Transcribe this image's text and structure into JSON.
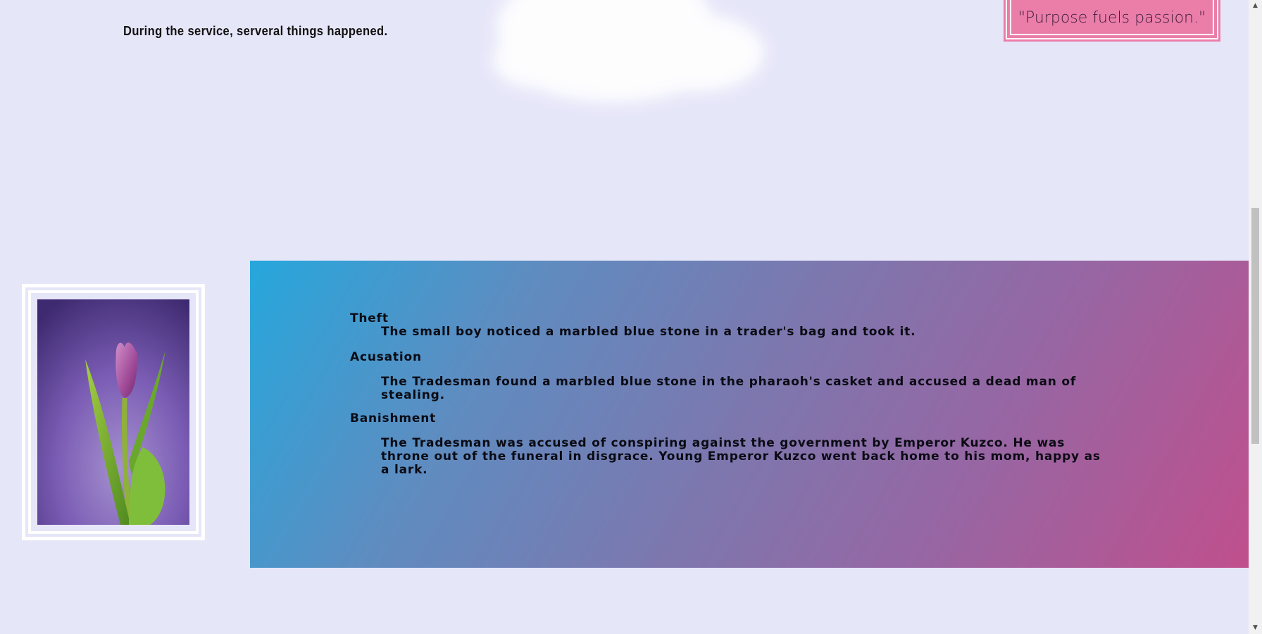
{
  "header": {
    "service_text": "During the service, serveral things happened.",
    "quote": "\"Purpose fuels passion.\""
  },
  "image": {
    "subject": "purple tulip photo"
  },
  "events": [
    {
      "term": "Theft",
      "description": "The small boy noticed a marbled blue stone in a trader's bag and took it."
    },
    {
      "term": "Acusation",
      "description": "The Tradesman found a marbled blue stone in the pharaoh's casket and accused a dead man of stealing."
    },
    {
      "term": "Banishment",
      "description": "The Tradesman was accused of conspiring against the government by Emperor Kuzco. He was throne out of the funeral in disgrace. Young Emperor Kuzco went back home to his mom, happy as a lark."
    }
  ],
  "colors": {
    "page_bg": "#e6e6f9",
    "quote_bg": "#ea7ea9",
    "gradient_start": "#26a7dc",
    "gradient_end": "#c04f8d"
  },
  "scrollbar": {
    "up_icon": "triangle-up",
    "down_icon": "triangle-down"
  }
}
